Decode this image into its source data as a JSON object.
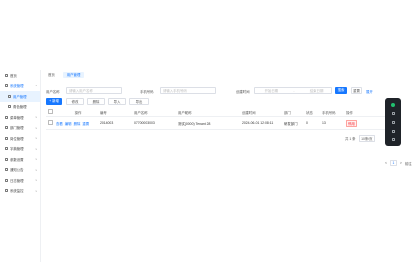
{
  "sidebar": {
    "items": [
      {
        "label": "首页",
        "type": "top"
      },
      {
        "label": "系统管理",
        "type": "parent-active"
      },
      {
        "label": "用户管理",
        "type": "sub-active"
      },
      {
        "label": "角色管理",
        "type": "sub"
      },
      {
        "label": "菜单管理",
        "type": "top"
      },
      {
        "label": "部门管理",
        "type": "top"
      },
      {
        "label": "岗位管理",
        "type": "top"
      },
      {
        "label": "字典管理",
        "type": "top"
      },
      {
        "label": "参数设置",
        "type": "top"
      },
      {
        "label": "通知公告",
        "type": "top"
      },
      {
        "label": "日志管理",
        "type": "top"
      },
      {
        "label": "系统监控",
        "type": "top"
      }
    ]
  },
  "tabs": [
    {
      "label": "首页"
    },
    {
      "label": "用户管理"
    }
  ],
  "filters": {
    "name_label": "用户名称",
    "name_placeholder": "请输入用户名称",
    "phone_label": "手机号码",
    "phone_placeholder": "请输入手机号码",
    "date_label": "创建时间",
    "date_start": "开始日期",
    "date_sep": "-",
    "date_end": "结束日期",
    "search": "搜索",
    "reset": "重置",
    "expand": "展开"
  },
  "toolbar": {
    "add": "+ 新增",
    "edit": "修改",
    "delete": "删除",
    "import": "导入",
    "export": "导出"
  },
  "table": {
    "headers": [
      "",
      "操作",
      "编号",
      "用户名称",
      "用户昵称",
      "创建时间",
      "部门",
      "状态",
      "手机号码",
      "操作"
    ],
    "rows": [
      {
        "actions": [
          "查看",
          "编辑",
          "删除",
          "重置"
        ],
        "id": "2014003",
        "username": "07700003003",
        "nickname": "测试(0000) Tenant 28",
        "created": "2024-06-01 12:08:11",
        "dept": "研发部门",
        "status": "0",
        "phone": "13",
        "op": "停用"
      }
    ]
  },
  "pagination": {
    "total": "共 1 条",
    "page_size": "10条/页",
    "current": "1",
    "goto": "前往"
  },
  "float_panel": {
    "icons": [
      "status-dot-icon",
      "settings-icon",
      "refresh-icon",
      "fullscreen-icon",
      "close-icon"
    ]
  },
  "colors": {
    "primary": "#1677ff",
    "danger": "#f5222d",
    "float_bg": "#1f2329"
  }
}
